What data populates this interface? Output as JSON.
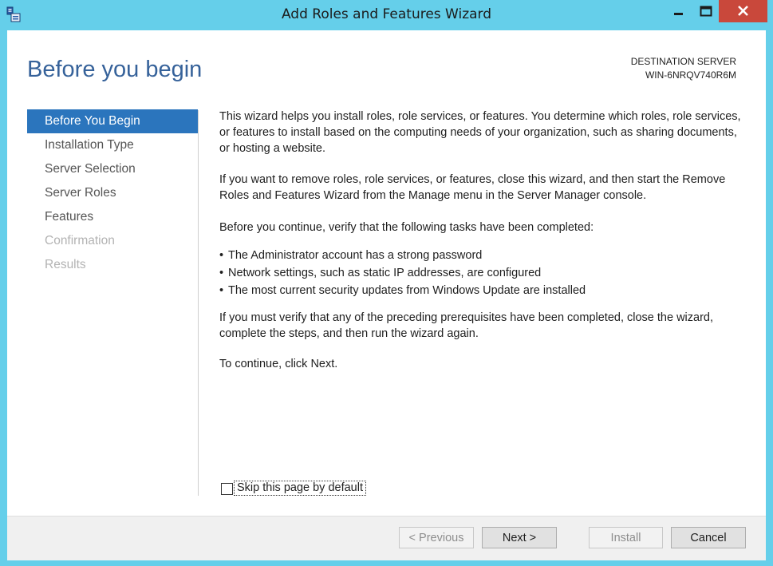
{
  "window": {
    "title": "Add Roles and Features Wizard"
  },
  "header": {
    "page_title": "Before you begin",
    "destination_label": "DESTINATION SERVER",
    "destination_value": "WIN-6NRQV740R6M"
  },
  "nav": {
    "items": [
      {
        "label": "Before You Begin",
        "state": "active"
      },
      {
        "label": "Installation Type",
        "state": "normal"
      },
      {
        "label": "Server Selection",
        "state": "normal"
      },
      {
        "label": "Server Roles",
        "state": "normal"
      },
      {
        "label": "Features",
        "state": "normal"
      },
      {
        "label": "Confirmation",
        "state": "disabled"
      },
      {
        "label": "Results",
        "state": "disabled"
      }
    ]
  },
  "content": {
    "para1": "This wizard helps you install roles, role services, or features. You determine which roles, role services, or features to install based on the computing needs of your organization, such as sharing documents, or hosting a website.",
    "para2": "If you want to remove roles, role services, or features, close this wizard, and then start the Remove Roles and Features Wizard from the Manage menu in the Server Manager console.",
    "para3": "Before you continue, verify that the following tasks have been completed:",
    "bullets": [
      "The Administrator account has a strong password",
      "Network settings, such as static IP addresses, are configured",
      "The most current security updates from Windows Update are installed"
    ],
    "para4": "If you must verify that any of the preceding prerequisites have been completed, close the wizard, complete the steps, and then run the wizard again.",
    "para5": "To continue, click Next."
  },
  "skip_checkbox": {
    "label": "Skip this page by default",
    "checked": false
  },
  "buttons": {
    "previous": "< Previous",
    "next": "Next >",
    "install": "Install",
    "cancel": "Cancel"
  },
  "colors": {
    "titlebar": "#65cfea",
    "accent": "#2b75bd",
    "page_title": "#36629a",
    "close_button": "#c9483b"
  }
}
